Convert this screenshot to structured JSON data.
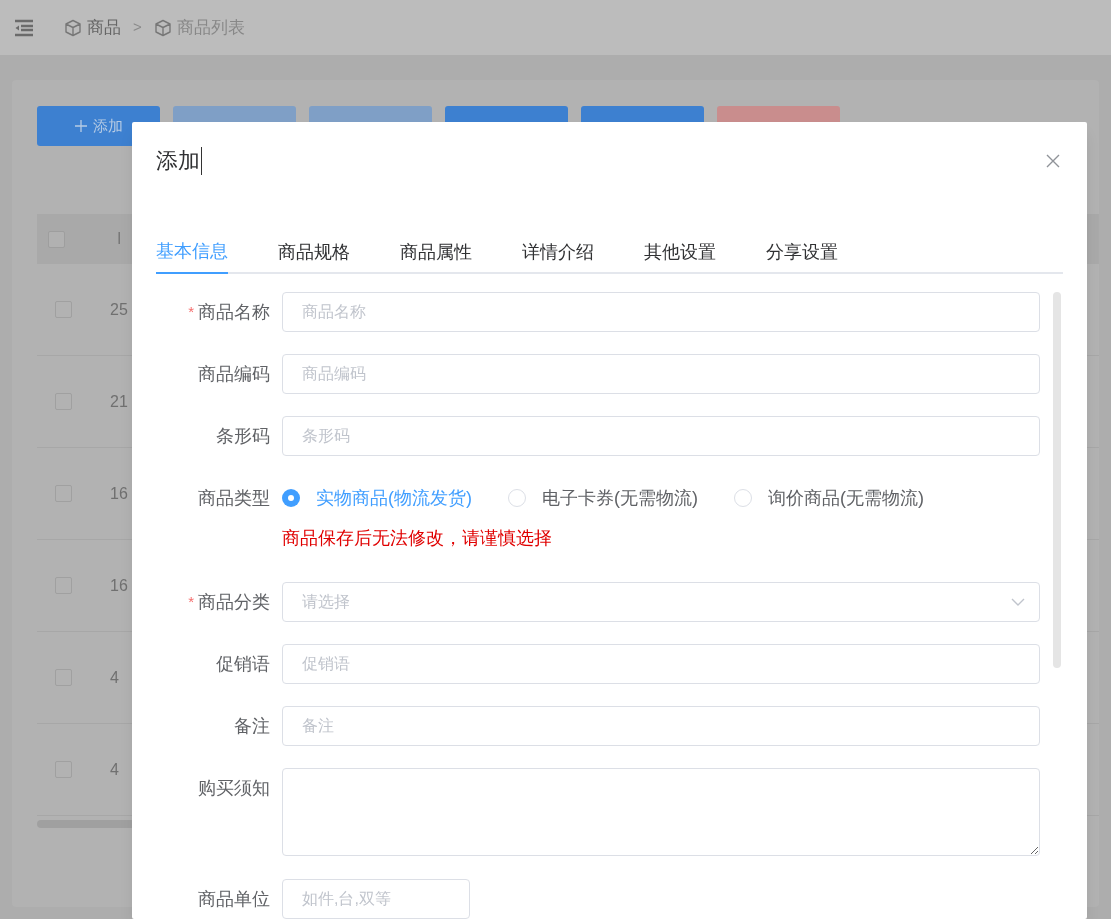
{
  "header": {
    "separator": ">",
    "breadcrumb": [
      {
        "label": "商品"
      },
      {
        "label": "商品列表"
      }
    ]
  },
  "toolbar": {
    "buttons": [
      {
        "kind": "primary",
        "label": "添加"
      },
      {
        "kind": "muted"
      },
      {
        "kind": "muted"
      },
      {
        "kind": "primary"
      },
      {
        "kind": "primary"
      },
      {
        "kind": "danger"
      }
    ]
  },
  "table": {
    "columns": [
      "I"
    ],
    "all_checked": false,
    "rows": [
      {
        "id": "25",
        "checked": false
      },
      {
        "id": "21",
        "checked": false
      },
      {
        "id": "16",
        "checked": false
      },
      {
        "id": "16",
        "checked": false
      },
      {
        "id": "4",
        "checked": false
      },
      {
        "id": "4",
        "checked": false
      }
    ]
  },
  "dialog": {
    "title": "添加",
    "tabs": [
      {
        "label": "基本信息",
        "selected": true
      },
      {
        "label": "商品规格",
        "selected": false
      },
      {
        "label": "商品属性",
        "selected": false
      },
      {
        "label": "详情介绍",
        "selected": false
      },
      {
        "label": "其他设置",
        "selected": false
      },
      {
        "label": "分享设置",
        "selected": false
      }
    ],
    "fields": [
      {
        "kind": "input",
        "label": "商品名称",
        "required_mark": "*",
        "placeholder": "商品名称"
      },
      {
        "kind": "input",
        "label": "商品编码",
        "placeholder": "商品编码"
      },
      {
        "kind": "input",
        "label": "条形码",
        "placeholder": "条形码"
      },
      {
        "kind": "radio",
        "label": "商品类型",
        "options": [
          {
            "label": "实物商品(物流发货)",
            "selected": true
          },
          {
            "label": "电子卡券(无需物流)",
            "selected": false
          },
          {
            "label": "询价商品(无需物流)",
            "selected": false
          }
        ],
        "note": "商品保存后无法修改，请谨慎选择"
      },
      {
        "kind": "select",
        "label": "商品分类",
        "required_mark": "*",
        "placeholder": "请选择"
      },
      {
        "kind": "input",
        "label": "促销语",
        "placeholder": "促销语"
      },
      {
        "kind": "input",
        "label": "备注",
        "placeholder": "备注"
      },
      {
        "kind": "textarea",
        "label": "购买须知"
      },
      {
        "kind": "short",
        "label": "商品单位",
        "placeholder": "如件,台,双等"
      }
    ]
  }
}
